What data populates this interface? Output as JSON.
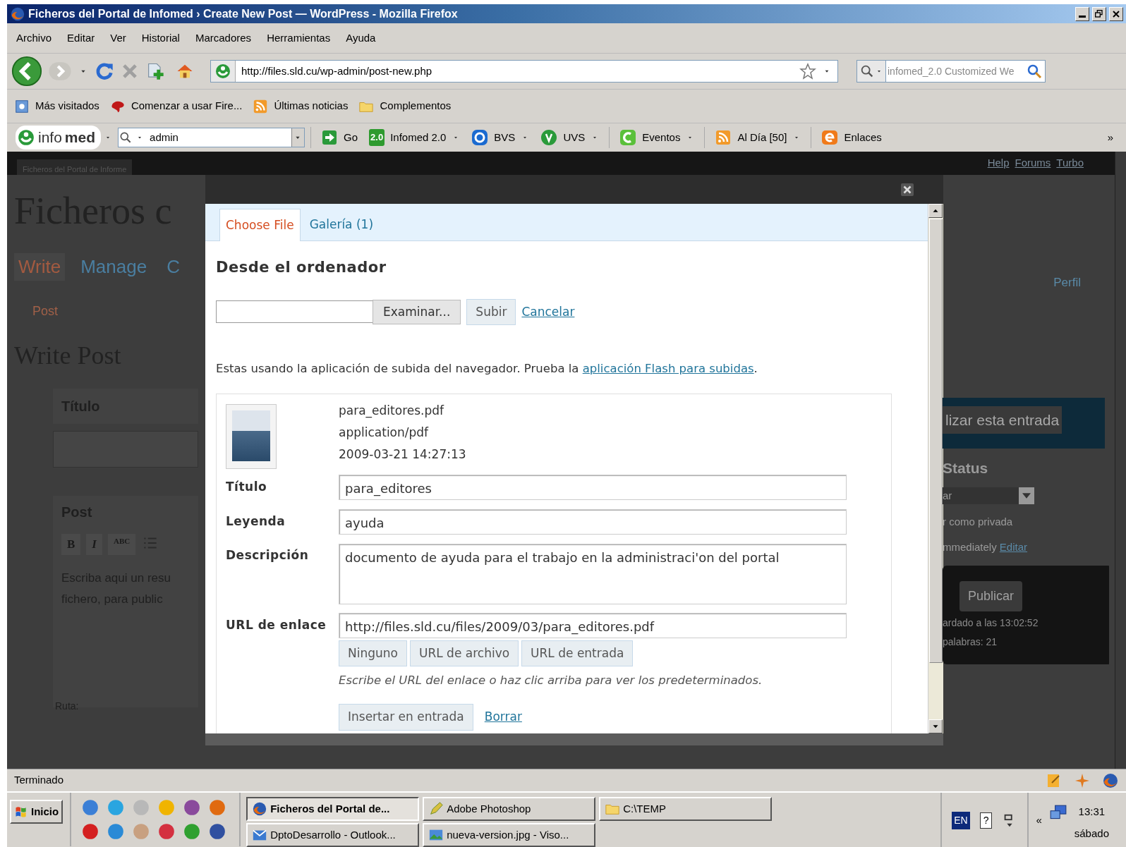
{
  "window": {
    "title": "Ficheros del Portal de Infomed › Create New Post — WordPress - Mozilla Firefox"
  },
  "menu": [
    "Archivo",
    "Editar",
    "Ver",
    "Historial",
    "Marcadores",
    "Herramientas",
    "Ayuda"
  ],
  "navigation": {
    "url": "http://files.sld.cu/wp-admin/post-new.php",
    "search_placeholder": "infomed_2.0 Customized We"
  },
  "bookmarks": [
    {
      "label": "Más visitados",
      "kind": "page"
    },
    {
      "label": "Comenzar a usar Fire...",
      "kind": "splash"
    },
    {
      "label": "Últimas noticias",
      "kind": "rss"
    },
    {
      "label": "Complementos",
      "kind": "folder"
    }
  ],
  "infomed_toolbar": {
    "logo": "info**med**",
    "search_value": "admin",
    "items": [
      {
        "label": "Go",
        "kind": "go",
        "dropdown": false,
        "separator": false
      },
      {
        "label": "Infomed 2.0",
        "kind": "badge",
        "badge": "2.0",
        "dropdown": true,
        "separator": false
      },
      {
        "label": "BVS",
        "kind": "ring",
        "dropdown": true,
        "separator": false
      },
      {
        "label": "UVS",
        "kind": "leaf",
        "dropdown": true,
        "separator": false
      },
      {
        "label": "Eventos",
        "kind": "arc",
        "dropdown": true,
        "separator": true
      },
      {
        "label": "Al Día [50]",
        "kind": "rss",
        "dropdown": true,
        "separator": true
      },
      {
        "label": "Enlaces",
        "kind": "e",
        "dropdown": false,
        "separator": true
      }
    ],
    "more": "»"
  },
  "background_page": {
    "site_tab": "Ficheros del Portal de Informe",
    "header_links": [
      "Help",
      "Forums",
      "Turbo"
    ],
    "site_title": "Ficheros c",
    "menu": [
      {
        "label": "Write",
        "selected": true
      },
      {
        "label": "Manage",
        "selected": false
      },
      {
        "label": "C",
        "selected": false
      }
    ],
    "profile_link": "Perfil",
    "submenu": "Post",
    "page_title": "Write Post",
    "title_box": "Título",
    "post_box": "Post",
    "editor_buttons": [
      "B",
      "I",
      "ABC"
    ],
    "editor_text": "Escriba aqui un resu fichero, para public",
    "path_label": "Ruta:",
    "preview_button": "lizar esta entrada",
    "status_heading": "Status",
    "status_select": "ar",
    "private_text": "r como privada",
    "publish_text": "mmediately",
    "edit_link": "Editar",
    "publish_button": "Publicar",
    "info_lines": [
      "ardado a las 13:02:52",
      "palabras: 21"
    ]
  },
  "dialog": {
    "tabs": [
      {
        "label": "Choose File",
        "selected": true
      },
      {
        "label": "Galería (1)",
        "selected": false
      }
    ],
    "heading": "Desde el ordenador",
    "browse_button": "Examinar...",
    "submit_button": "Subir",
    "cancel_link": "Cancelar",
    "notice": "Estas usando la aplicación de subida del navegador. Prueba la ",
    "notice_link": "aplicación Flash para subidas",
    "notice_end": ".",
    "file": {
      "name": "para_editores.pdf",
      "type": "application/pdf",
      "date": "2009-03-21 14:27:13"
    },
    "fields": [
      {
        "label": "Título",
        "value": "para_editores",
        "kind": "input"
      },
      {
        "label": "Leyenda",
        "value": "ayuda",
        "kind": "input"
      },
      {
        "label": "Descripción",
        "value": "documento de ayuda para el trabajo en la administraci'on del portal",
        "kind": "textarea"
      },
      {
        "label": "URL de enlace",
        "value": "http://files.sld.cu/files/2009/03/para_editores.pdf",
        "kind": "input"
      }
    ],
    "url_buttons": [
      "Ninguno",
      "URL de archivo",
      "URL de entrada"
    ],
    "url_help": "Escribe el URL del enlace o haz clic arriba para ver los predeterminados.",
    "insert_button": "Insertar en entrada",
    "delete_link": "Borrar"
  },
  "status_bar": {
    "text": "Terminado"
  },
  "taskbar": {
    "start": "Inicio",
    "quick_launch": [
      {
        "color": "#3b7fd6"
      },
      {
        "color": "#2aa5e0"
      },
      {
        "color": "#b8b8b8"
      },
      {
        "color": "#f0b400"
      },
      {
        "color": "#8a4a9c"
      },
      {
        "color": "#e06a10"
      },
      {
        "color": "#d42020"
      },
      {
        "color": "#2a8ad6"
      },
      {
        "color": "#c8a080"
      },
      {
        "color": "#d43040"
      },
      {
        "color": "#30a030"
      },
      {
        "color": "#3050a0"
      }
    ],
    "tasks": [
      {
        "label": "Ficheros del Portal de...",
        "kind": "globe",
        "selected": true
      },
      {
        "label": "Adobe Photoshop",
        "kind": "pencil",
        "selected": false
      },
      {
        "label": "C:\\TEMP",
        "kind": "folder",
        "selected": false
      },
      {
        "label": "DptoDesarrollo - Outlook...",
        "kind": "mail",
        "selected": false
      },
      {
        "label": "nueva-version.jpg - Viso...",
        "kind": "picture",
        "selected": false
      }
    ],
    "language": "EN",
    "help_key": "?",
    "expand": "«",
    "time": "13:31",
    "day": "sábado"
  }
}
